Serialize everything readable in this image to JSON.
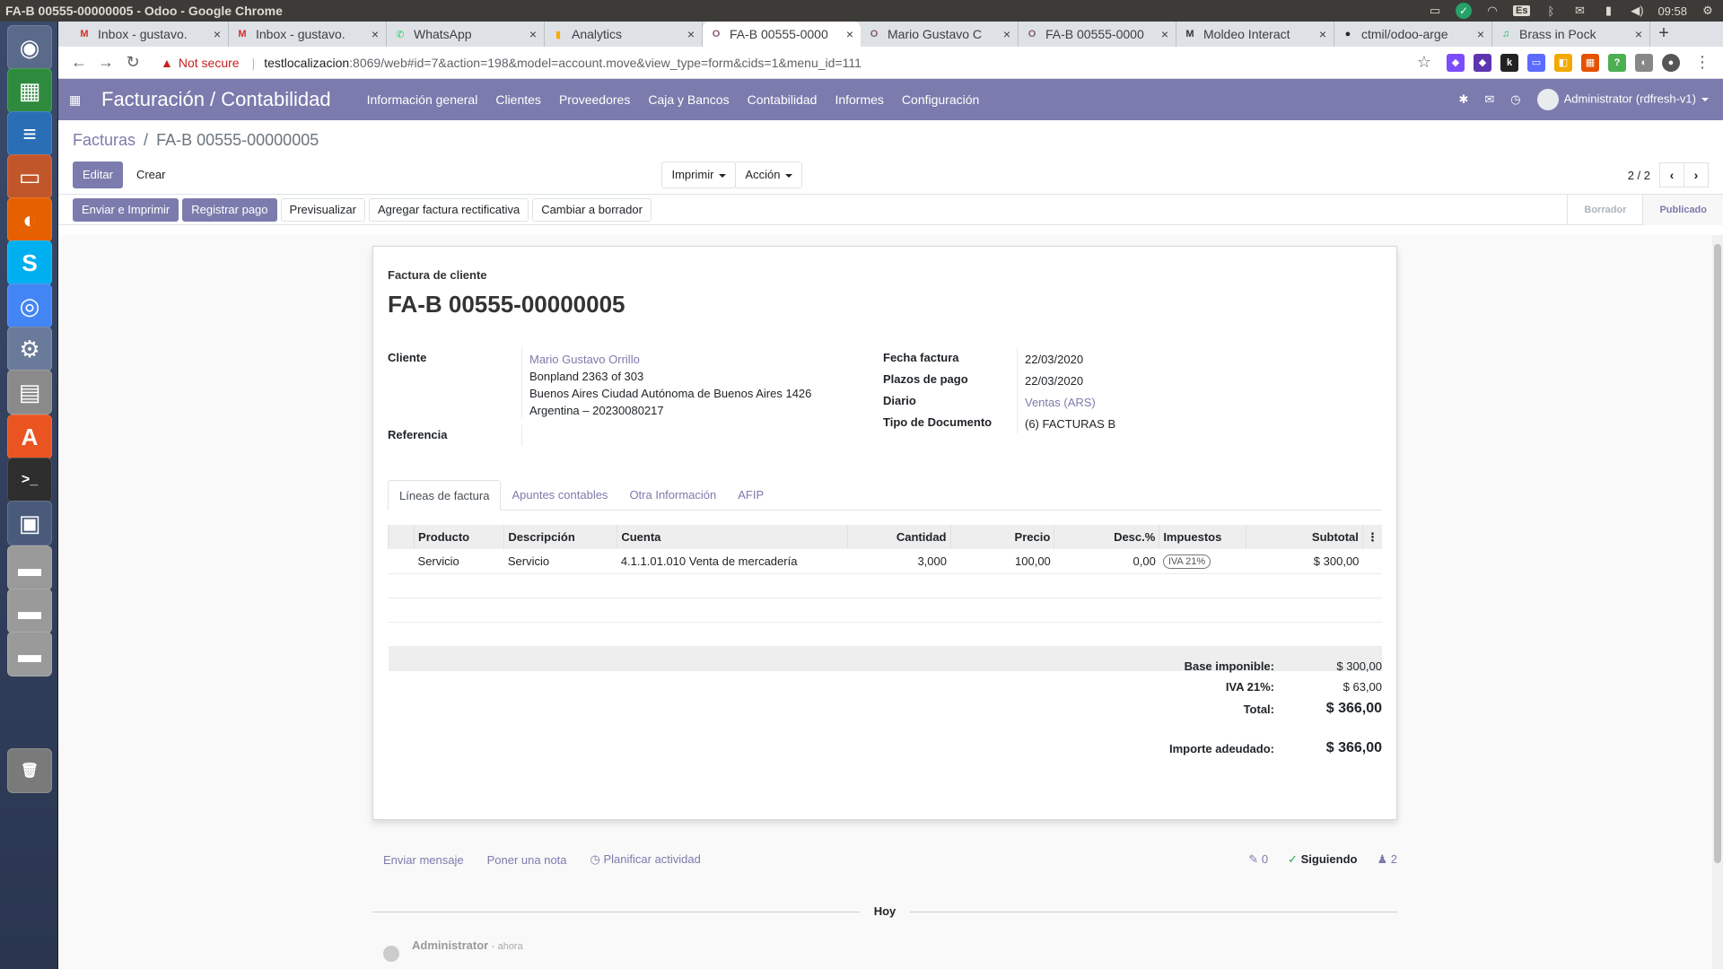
{
  "window_title": "FA-B 00555-00000005 - Odoo - Google Chrome",
  "tray": {
    "keyboard": "Es",
    "time": "09:58"
  },
  "launcher": [
    {
      "name": "ubuntu-dash-icon",
      "glyph": "◉",
      "color": "#5a6a8a"
    },
    {
      "name": "spreadsheet-icon",
      "glyph": "▦",
      "color": "#2e8b3e"
    },
    {
      "name": "writer-icon",
      "glyph": "≡",
      "color": "#2a6fb5"
    },
    {
      "name": "impress-icon",
      "glyph": "▭",
      "color": "#c2562b"
    },
    {
      "name": "firefox-icon",
      "glyph": "◐",
      "color": "#e66000"
    },
    {
      "name": "skype-icon",
      "glyph": "S",
      "color": "#00aff0"
    },
    {
      "name": "chrome-icon",
      "glyph": "◎",
      "color": "#4285f4"
    },
    {
      "name": "settings-icon",
      "glyph": "⚙",
      "color": "#6a7a9a"
    },
    {
      "name": "files-icon",
      "glyph": "▤",
      "color": "#8a8a8a"
    },
    {
      "name": "software-center-icon",
      "glyph": "A",
      "color": "#e95420"
    },
    {
      "name": "terminal-icon",
      "glyph": ">_",
      "color": "#2e2e2e"
    },
    {
      "name": "workspaces-icon",
      "glyph": "▣",
      "color": "#4a5a7a"
    },
    {
      "name": "drive-icon-1",
      "glyph": "▬",
      "color": "#9a9a9a"
    },
    {
      "name": "drive-icon-2",
      "glyph": "▬",
      "color": "#9a9a9a"
    },
    {
      "name": "drive-icon-3",
      "glyph": "▬",
      "color": "#9a9a9a"
    },
    {
      "name": "trash-icon",
      "glyph": "🗑",
      "color": "#7a7a7a"
    }
  ],
  "tabs": [
    {
      "label": "Inbox - gustavo.",
      "fav": "M",
      "favcolor": "#d93025"
    },
    {
      "label": "Inbox - gustavo.",
      "fav": "M",
      "favcolor": "#d93025"
    },
    {
      "label": "WhatsApp",
      "fav": "✆",
      "favcolor": "#25d366"
    },
    {
      "label": "Analytics",
      "fav": "▮",
      "favcolor": "#f9ab00"
    },
    {
      "label": "FA-B 00555-0000",
      "fav": "O",
      "favcolor": "#875a7b"
    },
    {
      "label": "Mario Gustavo C",
      "fav": "O",
      "favcolor": "#875a7b"
    },
    {
      "label": "FA-B 00555-0000",
      "fav": "O",
      "favcolor": "#875a7b"
    },
    {
      "label": "Moldeo Interact",
      "fav": "M",
      "favcolor": "#333"
    },
    {
      "label": "ctmil/odoo-arge",
      "fav": "●",
      "favcolor": "#24292e"
    },
    {
      "label": "Brass in Pock",
      "fav": "♫",
      "favcolor": "#1db954"
    }
  ],
  "address": {
    "warning": "Not secure",
    "host": "testlocalizacion",
    "path": ":8069/web#id=7&action=198&model=account.move&view_type=form&cids=1&menu_id=111"
  },
  "odoo": {
    "app_title": "Facturación / Contabilidad",
    "menu": [
      "Información general",
      "Clientes",
      "Proveedores",
      "Caja y Bancos",
      "Contabilidad",
      "Informes",
      "Configuración"
    ],
    "user": "Administrator (rdfresh-v1)",
    "breadcrumb": {
      "parent": "Facturas",
      "sep": "/",
      "current": "FA-B 00555-00000005"
    },
    "buttons": {
      "edit": "Editar",
      "create": "Crear",
      "print": "Imprimir",
      "action": "Acción"
    },
    "pager": "2 / 2",
    "header_buttons": [
      "Enviar e Imprimir",
      "Registrar pago",
      "Previsualizar",
      "Agregar factura rectificativa",
      "Cambiar a borrador"
    ],
    "status_steps": [
      "Borrador",
      "Publicado"
    ],
    "invoice": {
      "type_label": "Factura de cliente",
      "name": "FA-B 00555-00000005",
      "left_fields": {
        "cliente_label": "Cliente",
        "cliente_name": "Mario Gustavo Orrillo",
        "address_1": "Bonpland 2363 of 303",
        "address_2": "Buenos Aires Ciudad Autónoma de Buenos Aires 1426",
        "address_3": "Argentina – 20230080217",
        "referencia_label": "Referencia"
      },
      "right_fields": [
        {
          "label": "Fecha factura",
          "value": "22/03/2020",
          "link": false
        },
        {
          "label": "Plazos de pago",
          "value": "22/03/2020",
          "link": false
        },
        {
          "label": "Diario",
          "value": "Ventas (ARS)",
          "link": true
        },
        {
          "label": "Tipo de Documento",
          "value": "(6) FACTURAS B",
          "link": false
        }
      ],
      "notebook_tabs": [
        "Líneas de factura",
        "Apuntes contables",
        "Otra Información",
        "AFIP"
      ],
      "columns": [
        "Producto",
        "Descripción",
        "Cuenta",
        "Cantidad",
        "Precio",
        "Desc.%",
        "Impuestos",
        "Subtotal"
      ],
      "lines": [
        {
          "producto": "Servicio",
          "descripcion": "Servicio",
          "cuenta": "4.1.1.01.010 Venta de mercadería",
          "cantidad": "3,000",
          "precio": "100,00",
          "desc": "0,00",
          "impuestos": "IVA 21%",
          "subtotal": "$ 300,00"
        }
      ],
      "totals": [
        {
          "label": "Base imponible:",
          "value": "$ 300,00",
          "big": false
        },
        {
          "label": "IVA 21%:",
          "value": "$ 63,00",
          "big": false
        },
        {
          "label": "Total:",
          "value": "$ 366,00",
          "big": true
        },
        {
          "label": "Importe adeudado:",
          "value": "$ 366,00",
          "big": true
        }
      ]
    },
    "chatter": {
      "send_message": "Enviar mensaje",
      "log_note": "Poner una nota",
      "schedule": "Planificar actividad",
      "attachments": "0",
      "following": "Siguiendo",
      "followers": "2",
      "today": "Hoy",
      "author": "Administrator",
      "when": "- ahora"
    }
  }
}
